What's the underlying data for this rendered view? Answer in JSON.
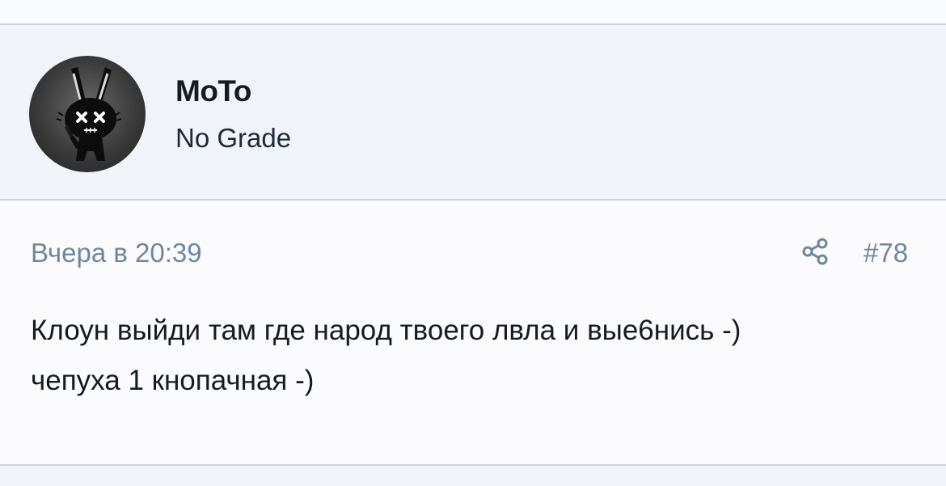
{
  "post": {
    "author": {
      "name": "MoTo",
      "title": "No Grade",
      "avatar_icon": "rabbit-avatar-icon"
    },
    "date": "Вчера в 20:39",
    "share_icon": "share-icon",
    "number": "#78",
    "message_lines": [
      "Клоун выйди там где народ твоего лвла и вые6нись -)",
      "чепуха 1 кнопачная -)"
    ]
  },
  "colors": {
    "header_bg": "#f0f3f7",
    "body_bg": "#fbfbfd",
    "divider": "#c9d3de",
    "muted_text": "#6d86a0",
    "main_text": "#141b25"
  }
}
